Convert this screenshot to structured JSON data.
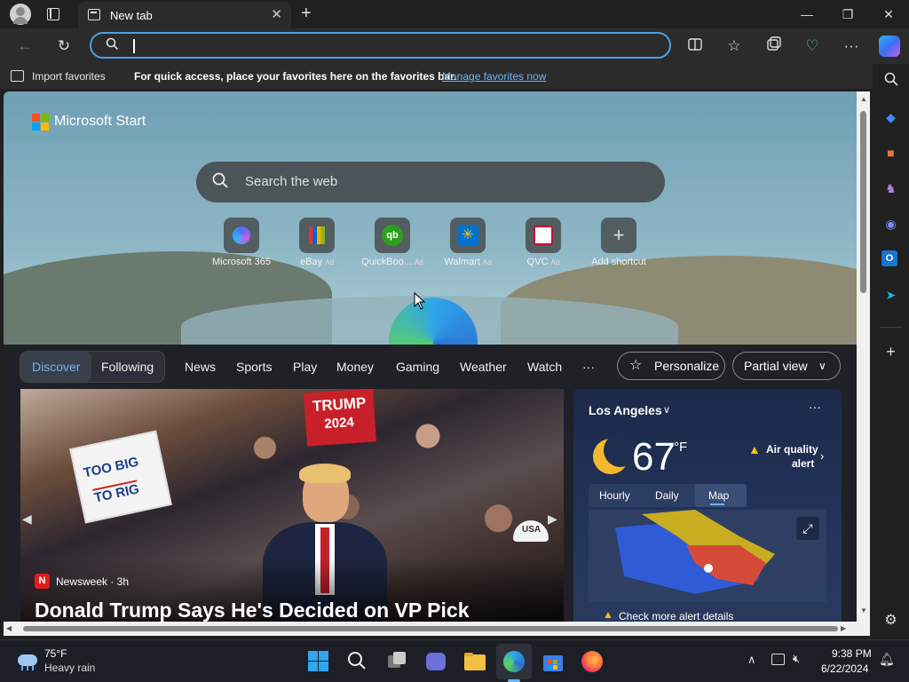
{
  "browser": {
    "tab_title": "New tab",
    "address_value": "",
    "favorites_bar": {
      "import_label": "Import favorites",
      "hint_text": "For quick access, place your favorites here on the favorites bar.",
      "manage_link": "Manage favorites now"
    }
  },
  "start_page": {
    "brand": "Microsoft Start",
    "search_placeholder": "Search the web",
    "shortcuts": [
      {
        "name": "Microsoft 365",
        "ad": ""
      },
      {
        "name": "eBay",
        "ad": "Ad"
      },
      {
        "name": "QuickBoo...",
        "ad": "Ad"
      },
      {
        "name": "Walmart",
        "ad": "Ad"
      },
      {
        "name": "QVC",
        "ad": "Ad"
      },
      {
        "name": "Add shortcut",
        "ad": ""
      }
    ],
    "feed_nav": {
      "tabs": [
        "Discover",
        "Following"
      ],
      "categories": [
        "News",
        "Sports",
        "Play",
        "Money",
        "Gaming",
        "Weather",
        "Watch"
      ],
      "more": "···",
      "personalize": "Personalize",
      "view_mode": "Partial view"
    },
    "hero": {
      "source": "Newsweek · 3h",
      "source_initial": "N",
      "headline": "Donald Trump Says He's Decided on VP Pick",
      "sign1_line1": "TOO BIG",
      "sign1_line2": "TO RIG",
      "sign2": "TRUMP",
      "sign2_year": "2024",
      "cap_text": "USA"
    },
    "weather": {
      "location": "Los Angeles",
      "temperature": "67",
      "unit": "°F",
      "alert_line1": "Air quality",
      "alert_line2": "alert",
      "tabs": [
        "Hourly",
        "Daily",
        "Map"
      ],
      "active_tab": "Map",
      "footer": "Check more alert details"
    }
  },
  "taskbar": {
    "weather_temp": "75°F",
    "weather_desc": "Heavy rain",
    "time": "9:38 PM",
    "date": "6/22/2024"
  },
  "colors": {
    "accent": "#4aa0e8",
    "frame_bg": "#202020",
    "toolbar_bg": "#2b2b2b",
    "feed_bg": "#1f2127",
    "link": "#6cb4f5"
  }
}
